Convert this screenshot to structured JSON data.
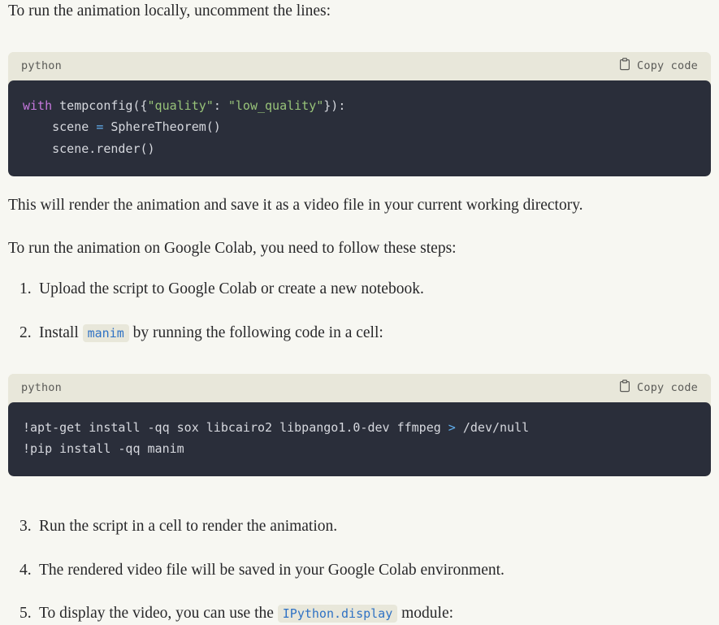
{
  "page": {
    "background_color": "#f7f7f2",
    "text_color": "#28282a"
  },
  "intro_paragraph": "To run the animation locally, uncomment the lines:",
  "code_block_1": {
    "language_label": "python",
    "copy_label": "Copy code",
    "copy_icon": "clipboard-icon",
    "background_color": "#2a2e3a",
    "header_background_color": "#e8e7da",
    "lines": [
      {
        "tokens": [
          {
            "text": "with",
            "type": "keyword"
          },
          {
            "text": " tempconfig({",
            "type": "plain"
          },
          {
            "text": "\"quality\"",
            "type": "string"
          },
          {
            "text": ": ",
            "type": "plain"
          },
          {
            "text": "\"low_quality\"",
            "type": "string"
          },
          {
            "text": "}):",
            "type": "plain"
          }
        ]
      },
      {
        "tokens": [
          {
            "text": "    scene ",
            "type": "plain"
          },
          {
            "text": "=",
            "type": "operator"
          },
          {
            "text": " SphereTheorem()",
            "type": "plain"
          }
        ]
      },
      {
        "tokens": [
          {
            "text": "    scene.render()",
            "type": "plain"
          }
        ]
      }
    ]
  },
  "paragraph_after_code_1": "This will render the animation and save it as a video file in your current working directory.",
  "paragraph_colab_intro": "To run the animation on Google Colab, you need to follow these steps:",
  "steps_group_1": [
    {
      "number": "1.",
      "parts": [
        {
          "text": "Upload the script to Google Colab or create a new notebook.",
          "type": "text"
        }
      ]
    },
    {
      "number": "2.",
      "parts": [
        {
          "text": "Install ",
          "type": "text"
        },
        {
          "text": "manim",
          "type": "code"
        },
        {
          "text": " by running the following code in a cell:",
          "type": "text"
        }
      ]
    }
  ],
  "code_block_2": {
    "language_label": "python",
    "copy_label": "Copy code",
    "copy_icon": "clipboard-icon",
    "background_color": "#2a2e3a",
    "header_background_color": "#e8e7da",
    "lines": [
      {
        "tokens": [
          {
            "text": "!apt-get install -qq sox libcairo2 libpango1.0-dev ffmpeg ",
            "type": "plain"
          },
          {
            "text": ">",
            "type": "operator"
          },
          {
            "text": " /dev/null",
            "type": "plain"
          }
        ]
      },
      {
        "tokens": [
          {
            "text": "!pip install -qq manim",
            "type": "plain"
          }
        ]
      }
    ]
  },
  "steps_group_2": [
    {
      "number": "3.",
      "parts": [
        {
          "text": "Run the script in a cell to render the animation.",
          "type": "text"
        }
      ]
    },
    {
      "number": "4.",
      "parts": [
        {
          "text": "The rendered video file will be saved in your Google Colab environment.",
          "type": "text"
        }
      ]
    },
    {
      "number": "5.",
      "parts": [
        {
          "text": "To display the video, you can use the ",
          "type": "text"
        },
        {
          "text": "IPython.display",
          "type": "code"
        },
        {
          "text": " module:",
          "type": "text"
        }
      ]
    }
  ],
  "syntax_colors": {
    "keyword": "#c678dd",
    "string": "#98c379",
    "operator": "#61afef",
    "plain": "#d6d8de",
    "inline_code_text": "#2f72c4",
    "inline_code_background": "#e8e7da"
  }
}
